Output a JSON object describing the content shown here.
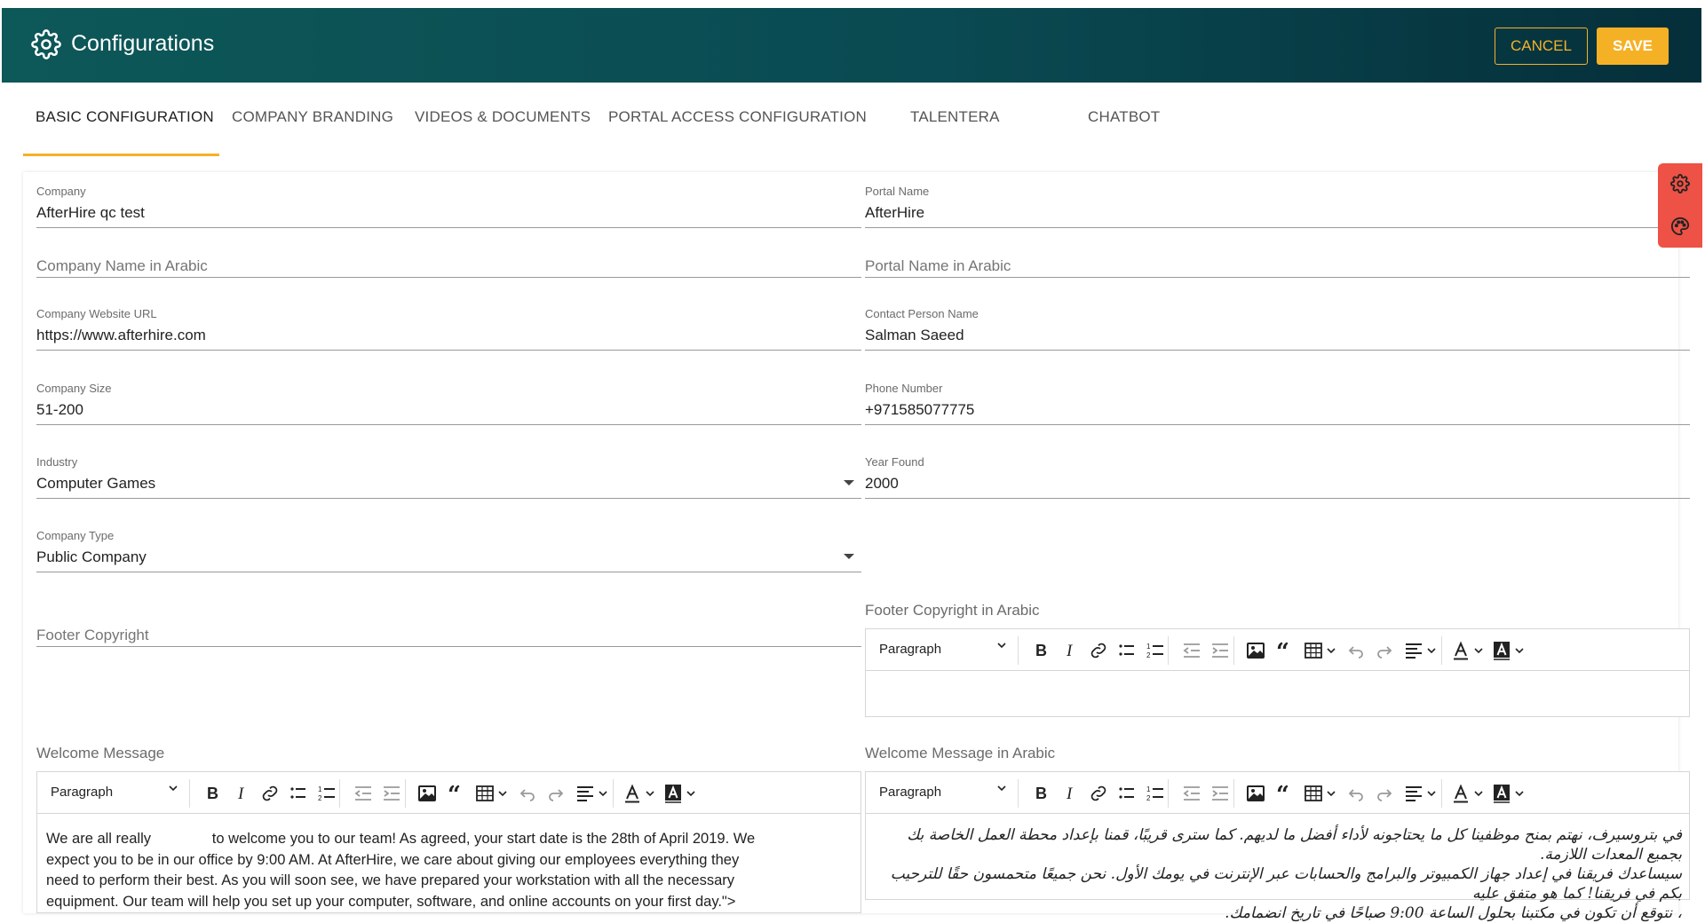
{
  "app": {
    "title": "Configurations",
    "icon": "gear-icon",
    "cancel_label": "CANCEL",
    "save_label": "SAVE",
    "accent": "#f5b125",
    "header_colors": [
      "#0d5858",
      "#052f3a"
    ]
  },
  "tabs": [
    {
      "label": "BASIC CONFIGURATION",
      "active": true
    },
    {
      "label": "COMPANY BRANDING",
      "active": false
    },
    {
      "label": "VIDEOS & DOCUMENTS",
      "active": false
    },
    {
      "label": "PORTAL ACCESS CONFIGURATION",
      "active": false
    },
    {
      "label": "TALENTERA",
      "active": false
    },
    {
      "label": "CHATBOT",
      "active": false
    }
  ],
  "left": {
    "company": {
      "label": "Company",
      "value": "AfterHire qc test"
    },
    "company_arabic": {
      "placeholder": "Company Name in Arabic"
    },
    "website": {
      "label": "Company Website URL",
      "value": "https://www.afterhire.com"
    },
    "size": {
      "label": "Company Size",
      "value": "51-200"
    },
    "industry": {
      "label": "Industry",
      "value": "Computer Games"
    },
    "type": {
      "label": "Company Type",
      "value": "Public Company"
    },
    "footer": {
      "placeholder": "Footer Copyright"
    },
    "welcome": {
      "label": "Welcome Message",
      "paragraph": "Paragraph",
      "lines": [
        "We are all really               to welcome you to our team! As agreed, your start date is the 28th of April 2019. We",
        "expect you to be in our office by 9:00 AM. At AfterHire, we care about giving our employees everything they",
        "need to perform their best. As you will soon see, we have prepared your workstation with all the necessary",
        "equipment. Our team will help you set up your computer, software, and online accounts on your first day.\">"
      ]
    }
  },
  "right": {
    "portal": {
      "label": "Portal Name",
      "value": "AfterHire"
    },
    "portal_arabic": {
      "placeholder": "Portal Name in Arabic"
    },
    "contact": {
      "label": "Contact Person Name",
      "value": "Salman Saeed"
    },
    "phone": {
      "label": "Phone Number",
      "value": "+971585077775"
    },
    "year": {
      "label": "Year Found",
      "value": "2000"
    },
    "footer_arabic": {
      "label": "Footer Copyright in Arabic",
      "paragraph": "Paragraph"
    },
    "welcome_arabic": {
      "label": "Welcome Message in Arabic",
      "paragraph": "Paragraph",
      "lines": [
        "في بتروسيرف، نهتم بمنح موظفينا كل ما يحتاجونه لأداء أفضل ما لديهم. كما سترى قريبًا، قمنا بإعداد محطة العمل الخاصة بك بجميع المعدات اللازمة.",
        "سيساعدك فريقنا في إعداد جهاز الكمبيوتر والبرامج والحسابات عبر الإنترنت في يومك الأول. نحن جميعًا متحمسون حقًا للترحيب بكم في فريقنا! كما هو متفق عليه",
        "، نتوقع أن تكون في مكتبنا بحلول الساعة 9:00 صباحًا في تاريخ انضمامك."
      ]
    }
  },
  "side_tools": [
    "gear-icon",
    "palette-icon"
  ]
}
